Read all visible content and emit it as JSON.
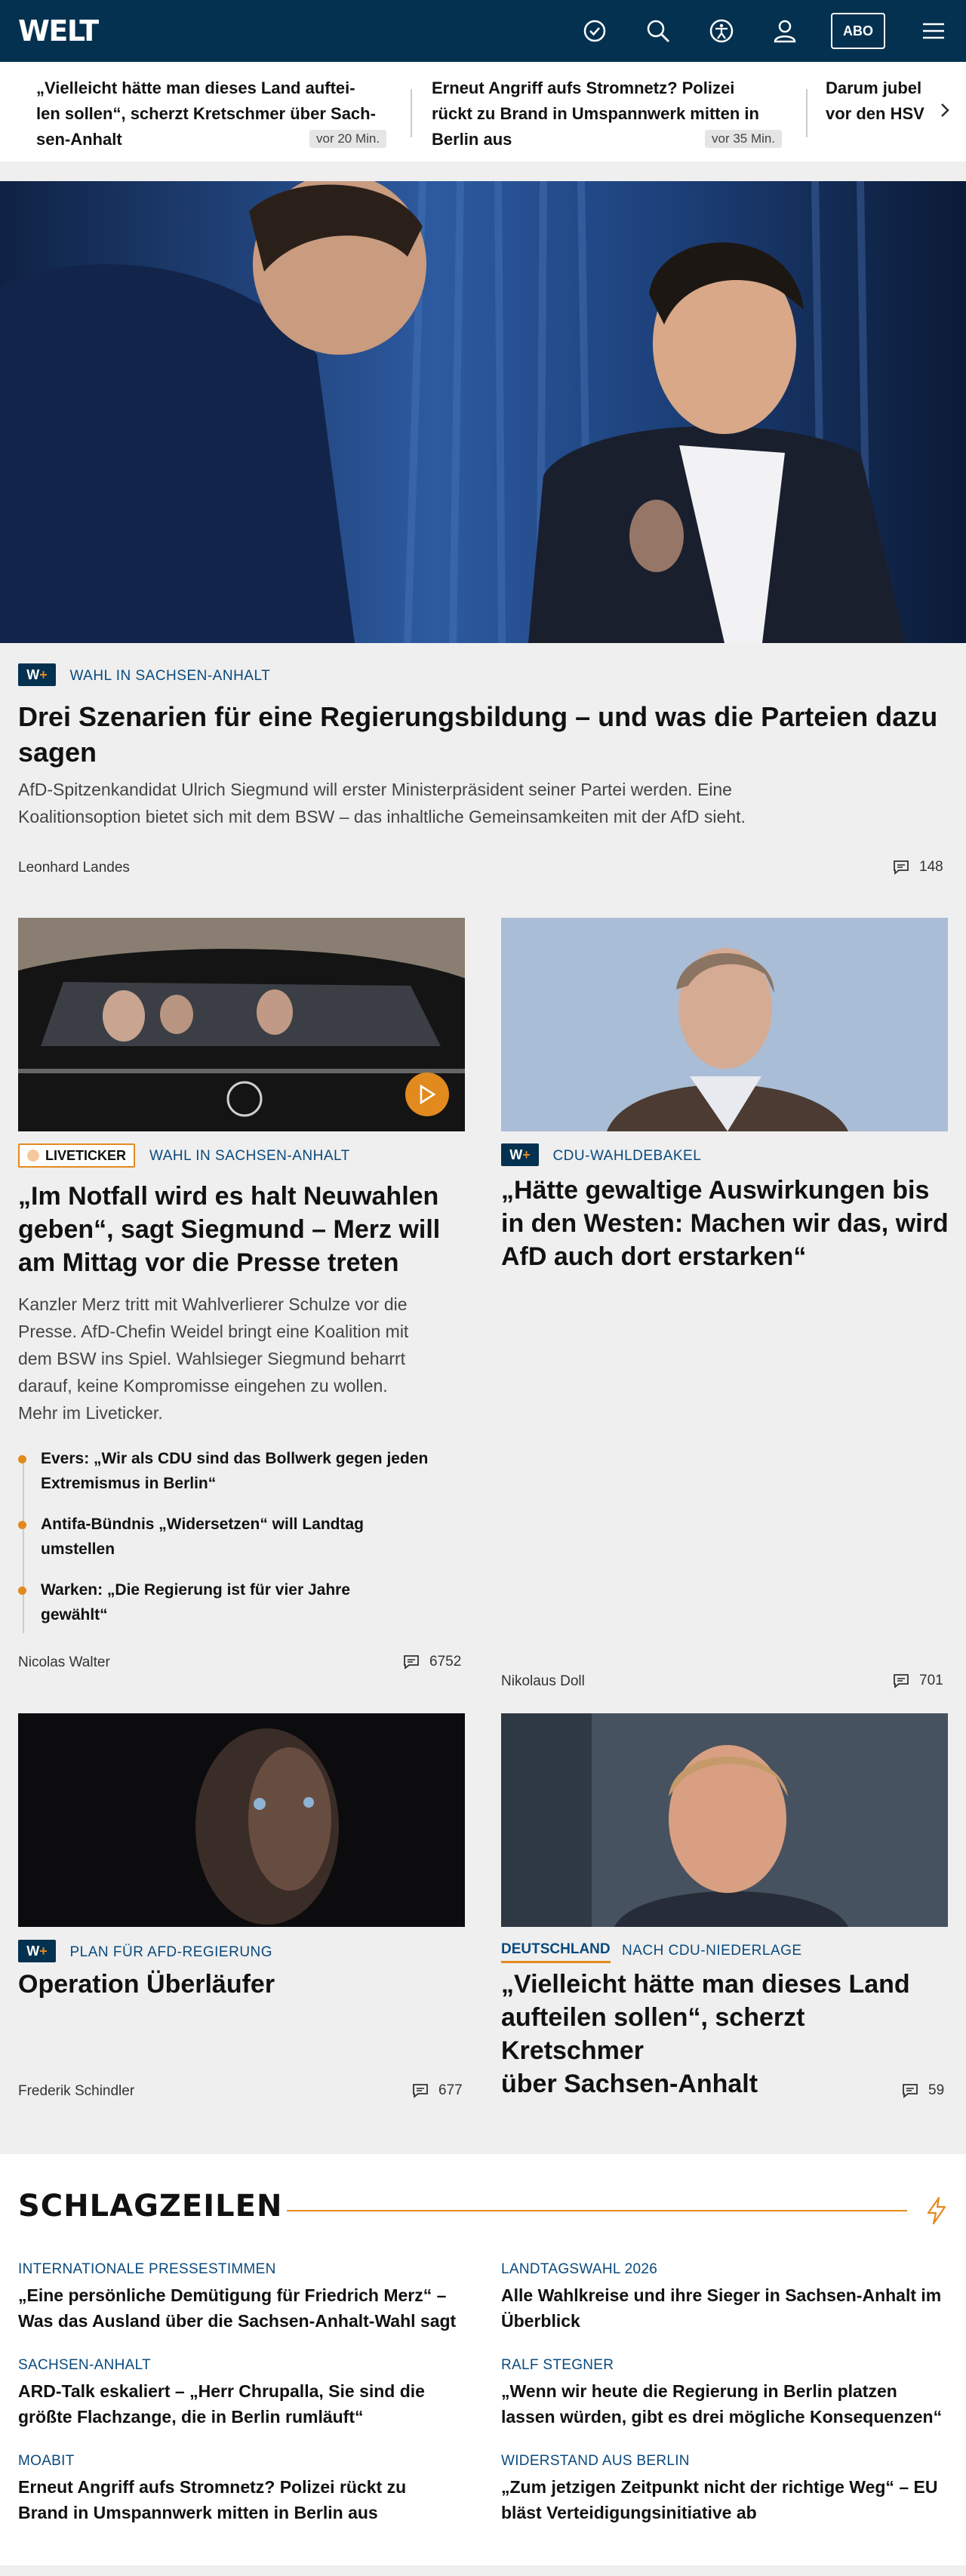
{
  "header": {
    "logo": "WELT",
    "abo_label": "ABO",
    "icons": [
      "clock-check-icon",
      "search-icon",
      "accessibility-icon",
      "user-icon",
      "hamburger-menu-icon"
    ]
  },
  "ticker": {
    "items": [
      {
        "text": "„Vielleicht hätte man dieses Land auftei-len sollen“, scherzt Kretschmer über Sach-sen-Anhalt",
        "line1": "„Vielleicht hätte man dieses Land auftei-",
        "line2": "len sollen“, scherzt Kretschmer über Sach-",
        "line3": "sen-Anhalt",
        "time": "vor 20 Min."
      },
      {
        "text": "Erneut Angriff aufs Stromnetz? Polizei rückt zu Brand in Umspannwerk mitten in Berlin aus",
        "line1": "Erneut Angriff aufs Stromnetz? Polizei",
        "line2": "rückt zu Brand in Umspannwerk mitten in",
        "line3": "Berlin aus",
        "time": "vor 35 Min."
      },
      {
        "line1": "Darum jubel",
        "line2": "vor den HSV"
      }
    ]
  },
  "hero": {
    "kicker": "WAHL IN SACHSEN-ANHALT",
    "headline_l1": "Drei Szenarien für eine Regierungsbildung – und was die Parteien dazu",
    "headline_l2": "sagen",
    "lead_l1": "AfD-Spitzenkandidat Ulrich Siegmund will erster Ministerpräsident seiner Partei werden. Eine",
    "lead_l2": "Koalitionsoption bietet sich mit dem BSW – das inhaltliche Gemeinsamkeiten mit der AfD sieht.",
    "author": "Leonhard Landes",
    "comments": "148"
  },
  "card_live": {
    "badge": "LIVETICKER",
    "kicker": "WAHL IN SACHSEN-ANHALT",
    "h1": "„Im Notfall wird es halt Neuwahlen",
    "h2": "geben“, sagt Siegmund – Merz will",
    "h3": "am Mittag vor die Presse treten",
    "t1": "Kanzler Merz tritt mit Wahlverlierer Schulze vor die",
    "t2": "Presse. AfD-Chefin Weidel bringt eine Koalition mit",
    "t3": "dem BSW ins Spiel. Wahlsieger Siegmund beharrt",
    "t4": "darauf, keine Kompromisse eingehen zu wollen.",
    "t5": "Mehr im Liveticker.",
    "bullets": [
      {
        "l1": "Evers: „Wir als CDU sind das Bollwerk gegen jeden",
        "l2": "Extremismus in Berlin“"
      },
      {
        "l1": "Antifa-Bündnis „Widersetzen“ will Landtag",
        "l2": "umstellen"
      },
      {
        "l1": "Warken: „Die Regierung ist für vier Jahre",
        "l2": "gewählt“"
      }
    ],
    "author": "Nicolas Walter",
    "comments": "6752"
  },
  "card_doll": {
    "kicker": "CDU-WAHLDEBAKEL",
    "h1": "„Hätte gewaltige Auswirkungen bis",
    "h2": "in den Westen: Machen wir das, wird",
    "h3": "AfD auch dort erstarken“",
    "author": "Nikolaus Doll",
    "comments": "701"
  },
  "card_op": {
    "kicker": "PLAN FÜR AFD-REGIERUNG",
    "h1": "Operation Überläufer",
    "author": "Frederik Schindler",
    "comments": "677"
  },
  "card_kretschmer": {
    "section": "DEUTSCHLAND",
    "kicker": "NACH CDU-NIEDERLAGE",
    "h1": "„Vielleicht hätte man dieses Land",
    "h2": "aufteilen sollen“, scherzt Kretschmer",
    "h3": "über Sachsen-Anhalt",
    "comments": "59"
  },
  "schlagzeilen": {
    "title": "SCHLAGZEILEN",
    "items": [
      {
        "kicker": "INTERNATIONALE PRESSESTIMMEN",
        "l1": "„Eine persönliche Demütigung für Friedrich Merz“ –",
        "l2": "Was das Ausland über die Sachsen-Anhalt-Wahl sagt"
      },
      {
        "kicker": "LANDTAGSWAHL 2026",
        "l1": "Alle Wahlkreise und ihre Sieger in Sachsen-Anhalt im",
        "l2": "Überblick"
      },
      {
        "kicker": "SACHSEN-ANHALT",
        "l1": "ARD-Talk eskaliert – „Herr Chrupalla, Sie sind die",
        "l2": "größte Flachzange, die in Berlin rumläuft“"
      },
      {
        "kicker": "RALF STEGNER",
        "l1": "„Wenn wir heute die Regierung in Berlin platzen",
        "l2": "lassen würden, gibt es drei mögliche Konsequenzen“"
      },
      {
        "kicker": "MOABIT",
        "l1": "Erneut Angriff aufs Stromnetz? Polizei rückt zu",
        "l2": "Brand in Umspannwerk mitten in Berlin aus"
      },
      {
        "kicker": "WIDERSTAND AUS BERLIN",
        "l1": "„Zum jetzigen Zeitpunkt nicht der richtige Weg“ – EU",
        "l2": "bläst Verteidigungsinitiative ab"
      }
    ]
  },
  "colors": {
    "navy": "#053150",
    "accent": "#e28a1e",
    "kicker": "#0a4a7d"
  }
}
